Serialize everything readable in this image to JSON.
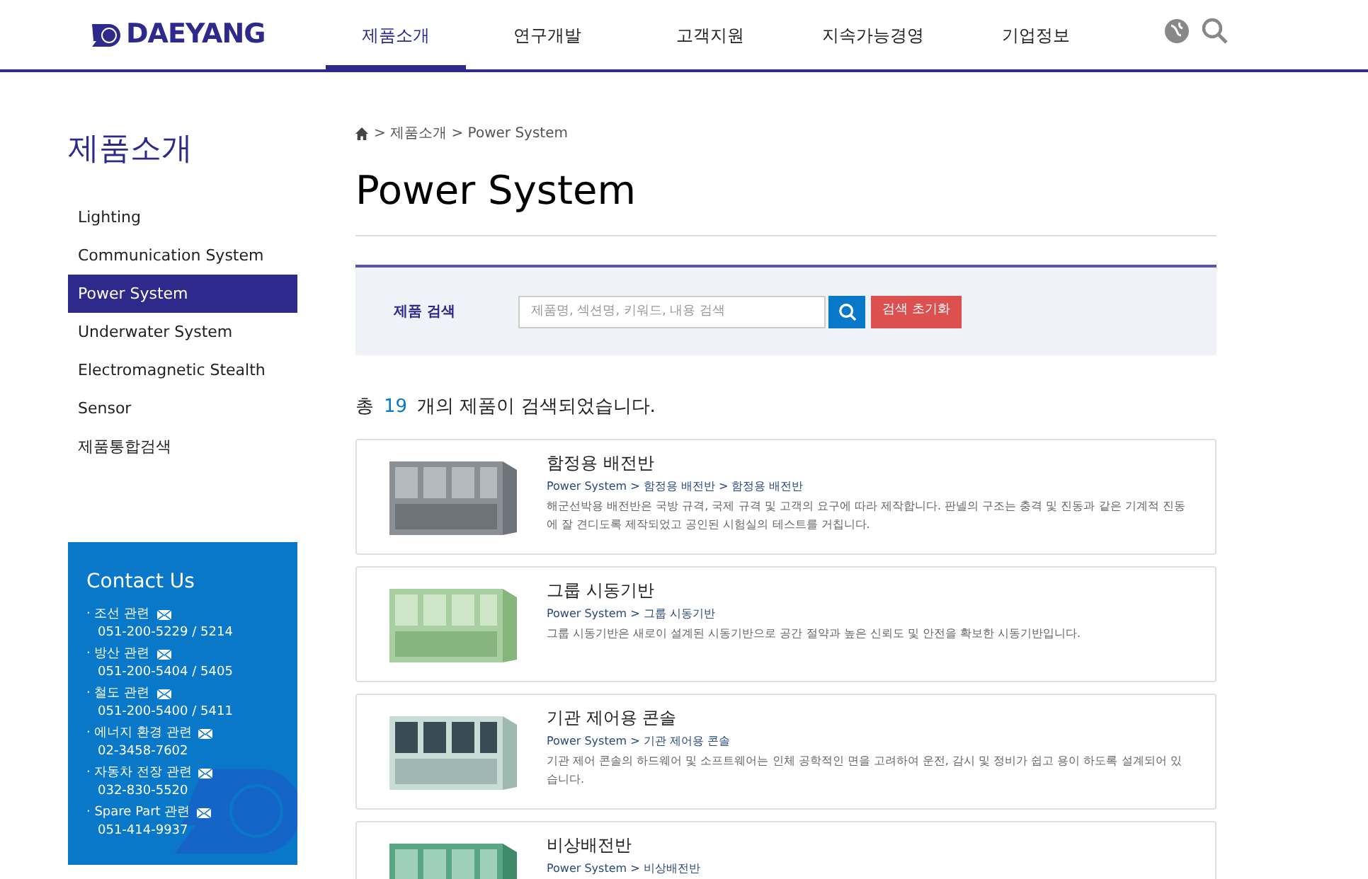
{
  "header": {
    "logo": "DAEYANG",
    "nav": [
      {
        "label": "제품소개",
        "selected": true
      },
      {
        "label": "연구개발",
        "selected": false
      },
      {
        "label": "고객지원",
        "selected": false
      },
      {
        "label": "지속가능경영",
        "selected": false
      },
      {
        "label": "기업정보",
        "selected": false
      }
    ]
  },
  "sidebar": {
    "title": "제품소개",
    "items": [
      {
        "label": "Lighting",
        "selected": false
      },
      {
        "label": "Communication System",
        "selected": false
      },
      {
        "label": "Power System",
        "selected": true
      },
      {
        "label": "Underwater System",
        "selected": false
      },
      {
        "label": "Electromagnetic Stealth",
        "selected": false
      },
      {
        "label": "Sensor",
        "selected": false
      },
      {
        "label": "제품통합검색",
        "selected": false
      }
    ],
    "contact": {
      "title": "Contact Us",
      "items": [
        {
          "label": "· 조선 관련",
          "phone": "051-200-5229 / 5214"
        },
        {
          "label": "· 방산 관련",
          "phone": "051-200-5404 / 5405"
        },
        {
          "label": "· 철도 관련",
          "phone": "051-200-5400 / 5411"
        },
        {
          "label": "· 에너지 환경 관련",
          "phone": "02-3458-7602"
        },
        {
          "label": "· 자동차 전장 관련",
          "phone": "032-830-5520"
        },
        {
          "label": "· Spare Part 관련",
          "phone": "051-414-9937"
        }
      ]
    }
  },
  "breadcrumb": [
    "> 제품소개 > Power System"
  ],
  "title": "Power System",
  "search": {
    "label": "제품 검색",
    "placeholder": "제품명, 섹션명, 키워드, 내용 검색",
    "reset": "검색 초기화"
  },
  "result": {
    "prefix": "총",
    "count": "19",
    "suffix": "개의 제품이 검색되었습니다."
  },
  "products": [
    {
      "name": "함정용 배전반",
      "path": "Power System > 함정용 배전반 > 함정용 배전반",
      "description": "해군선박용 배전반은 국방 규격, 국제 규격 및 고객의 요구에 따라 제작합니다. 판넬의 구조는 충격 및 진동과 같은 기계적 진동에 잘 견디도록 제작되었고 공인된 시험실의 테스트를 거칩니다.",
      "kind": "picture"
    },
    {
      "name": "그룹 시동기반",
      "path": "Power System > 그룹 시동기반",
      "description": "그룹 시동기반은 새로이 설계된 시동기반으로 공간 절약과 높은 신뢰도 및 안전을 확보한 시동기반입니다.",
      "kind": "picture"
    },
    {
      "name": "기관 제어용 콘솔",
      "path": "Power System > 기관 제어용 콘솔",
      "description": "기관 제어 콘솔의 하드웨어 및 소프트웨어는 인체 공학적인 면을 고려하여 운전, 감시 및 정비가 쉽고 용이 하도록 설계되어 있습니다.",
      "kind": "picture"
    },
    {
      "name": "비상배전반",
      "path": "Power System > 비상배전반",
      "kind": "picture"
    }
  ]
}
